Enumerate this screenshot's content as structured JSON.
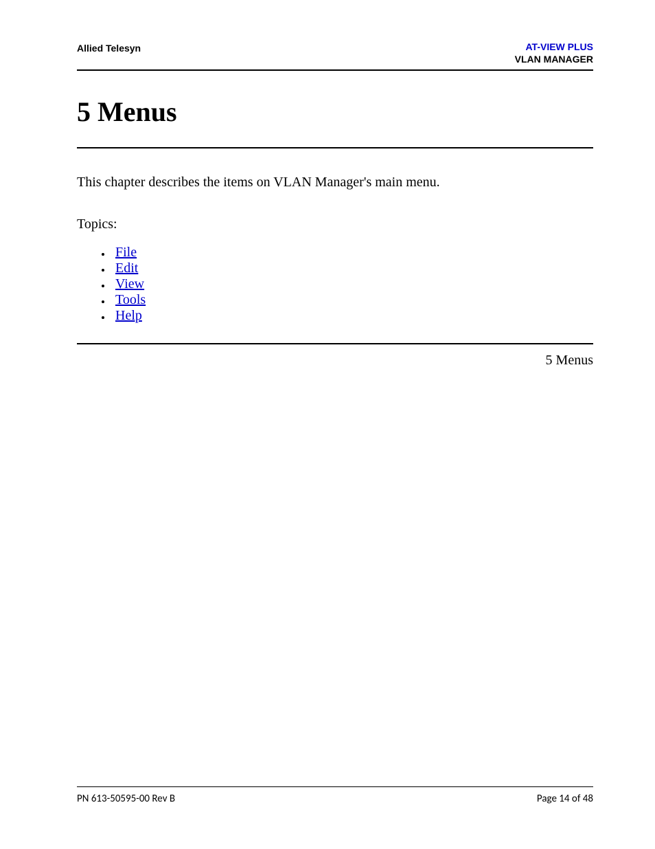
{
  "header": {
    "left": "Allied Telesyn",
    "right_line1": "AT-VIEW PLUS",
    "right_line2": "VLAN MANAGER"
  },
  "title": "5 Menus",
  "intro": "This chapter describes the items on VLAN Manager's main menu.",
  "topics_label": "Topics:",
  "topics": {
    "0": {
      "label": "File"
    },
    "1": {
      "label": "Edit"
    },
    "2": {
      "label": "View"
    },
    "3": {
      "label": "Tools"
    },
    "4": {
      "label": "Help"
    }
  },
  "section_footer": "5 Menus",
  "footer": {
    "left": "PN 613-50595-00 Rev B",
    "right": "Page 14 of 48"
  }
}
